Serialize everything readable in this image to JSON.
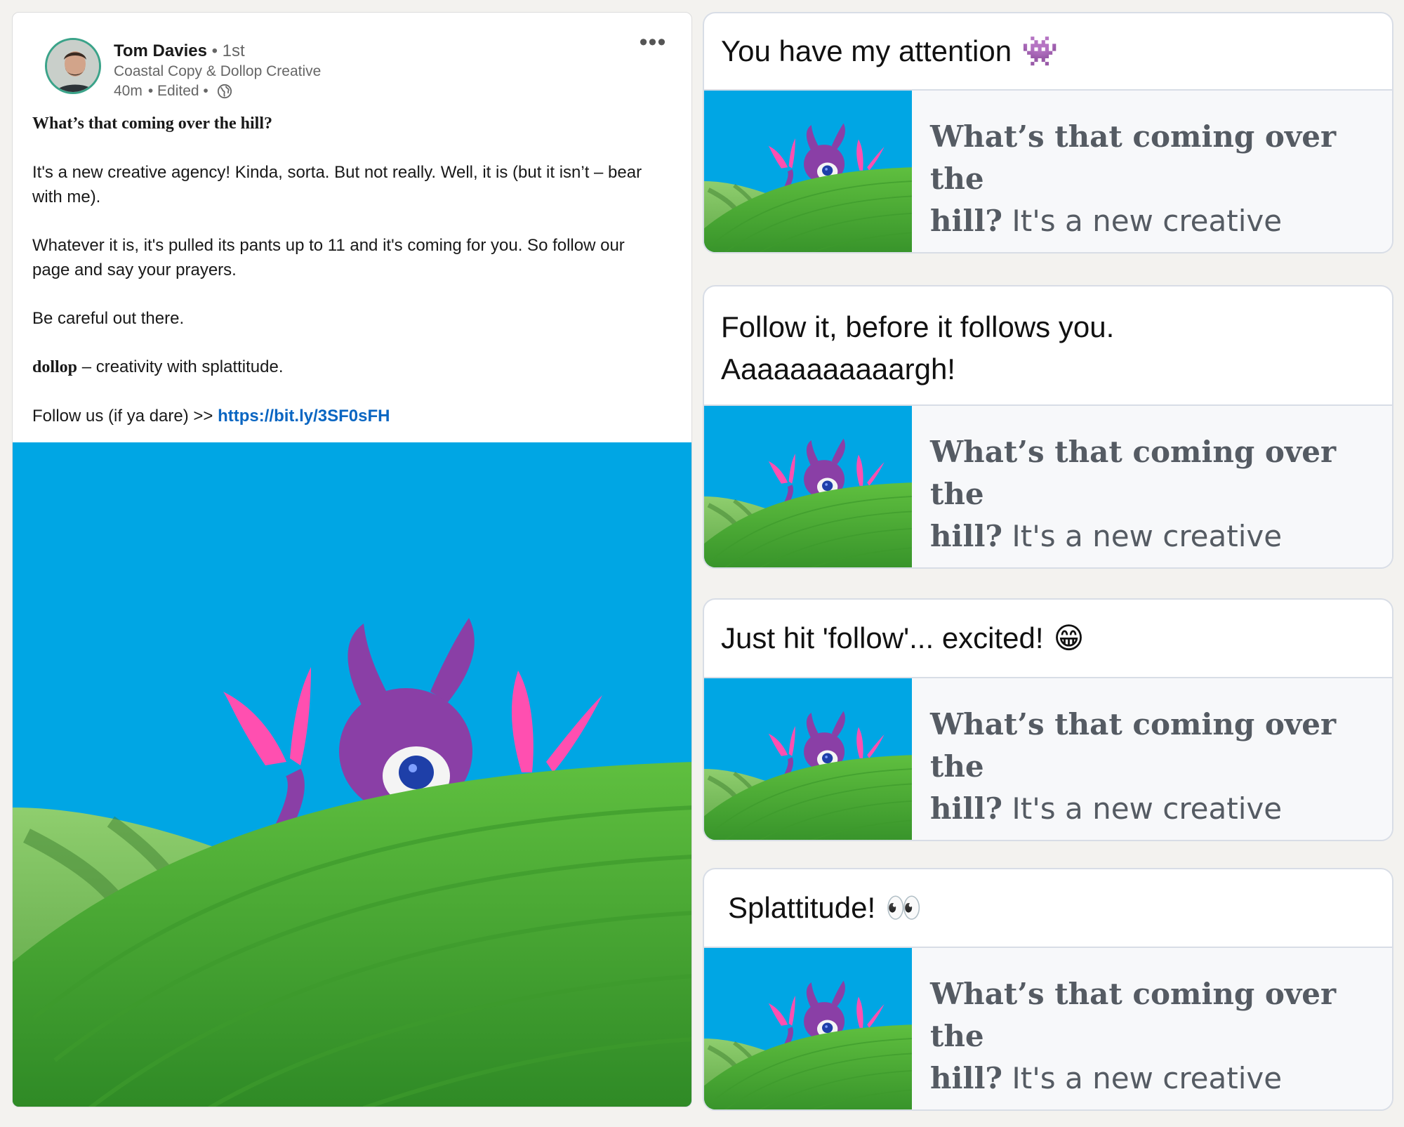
{
  "post": {
    "author_name": "Tom Davies",
    "author_degree": "• 1st",
    "author_headline": "Coastal Copy & Dollop Creative",
    "time": "40m",
    "edited": "• Edited •",
    "more_label": "•••",
    "heading": "What’s that coming over the hill?",
    "para1": "It's a new creative agency! Kinda, sorta. But not really. Well, it is (but it isn’t – bear with me).",
    "para2": "Whatever it is, it's pulled its pants up to 11 and it's coming for you. So follow our page and say your prayers.",
    "para3": "Be careful out there.",
    "brand": "dollop",
    "tagline": " – creativity with splattitude.",
    "follow_prefix": "Follow us (if ya dare) >> ",
    "link": "https://bit.ly/3SF0sFH"
  },
  "comments": [
    {
      "text": "You have my attention",
      "emoji": "👾",
      "preview_title": "What’s that coming over the",
      "preview_title2": "hill?",
      "preview_rest": " It's a new creative agency..."
    },
    {
      "text": "Follow it, before it follows you. Aaaaaaaaaaargh!",
      "emoji": "",
      "preview_title": "What’s that coming over the",
      "preview_title2": "hill?",
      "preview_rest": " It's a new creative agency..."
    },
    {
      "text": "Just hit 'follow'... excited!",
      "emoji": "😁",
      "preview_title": "What’s that coming over the",
      "preview_title2": "hill?",
      "preview_rest": " It's a new creative agency..."
    },
    {
      "text": "Splattitude!",
      "emoji": "👀",
      "preview_title": "What’s that coming over the",
      "preview_title2": "hill?",
      "preview_rest": " It's a new creative agency..."
    }
  ],
  "colors": {
    "link": "#0a66c2",
    "sky": "#00a6e4",
    "hill": "#4fa83a",
    "monster": "#8a3fa6",
    "claw": "#ff4fb0"
  }
}
